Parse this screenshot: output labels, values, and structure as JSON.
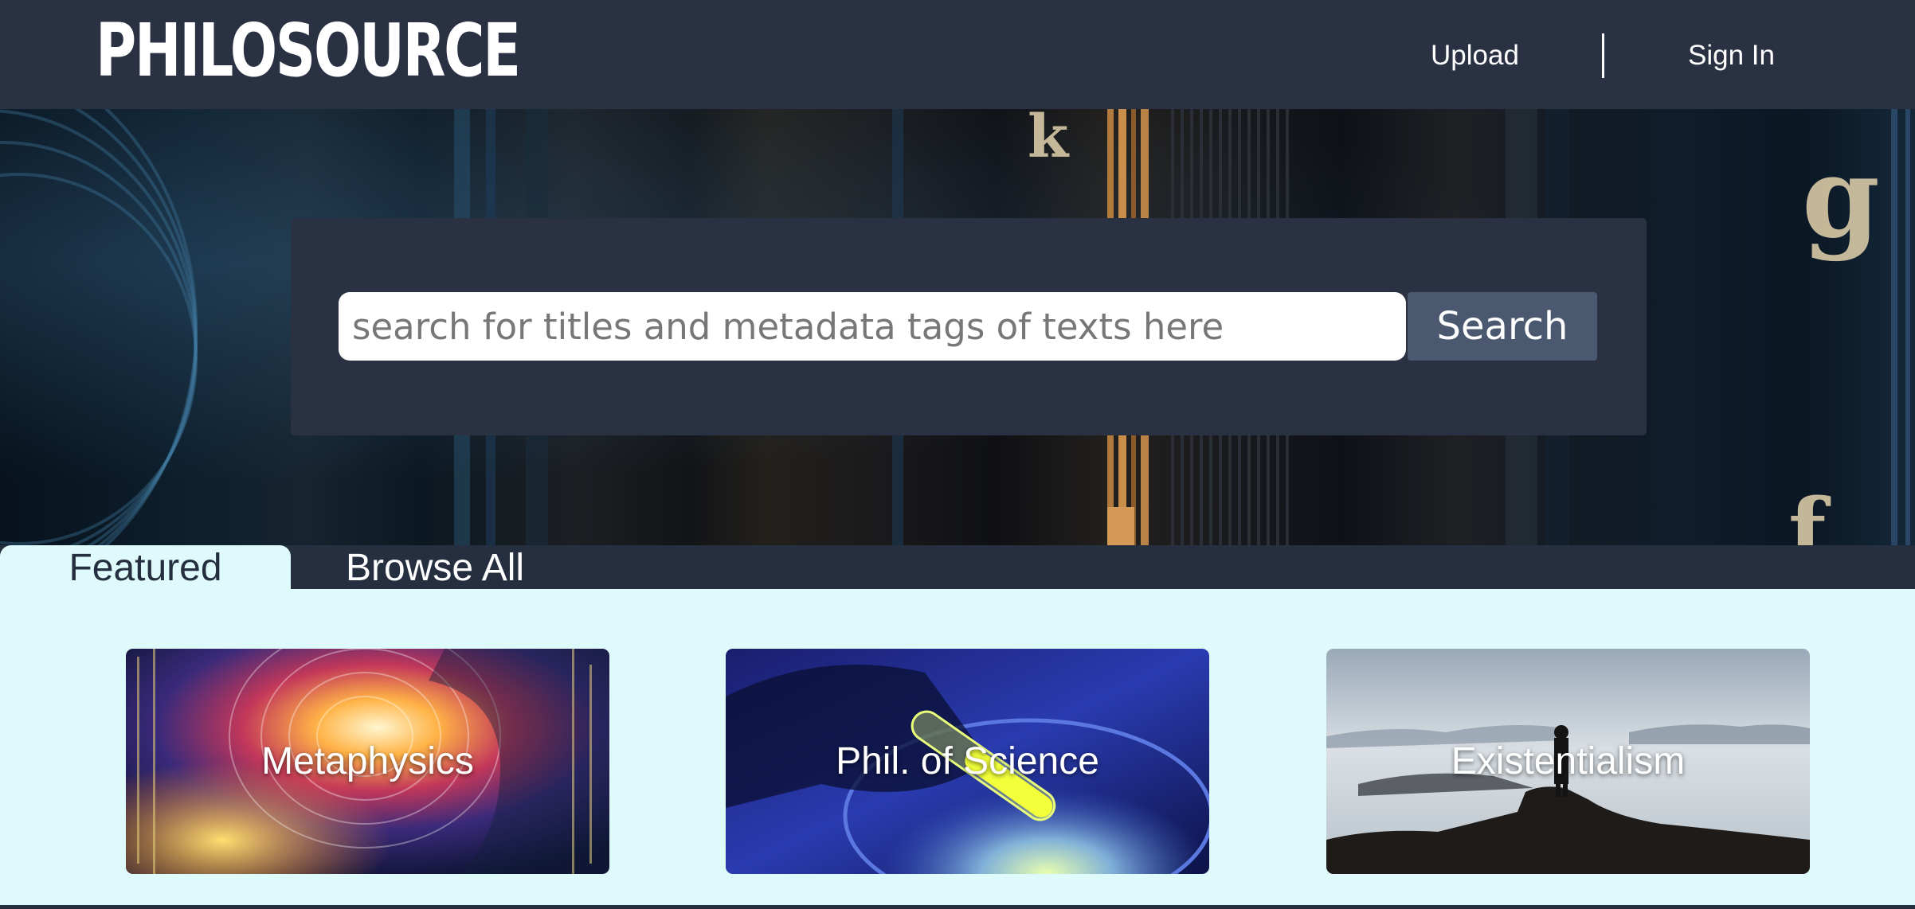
{
  "header": {
    "logo": "PHILOSOURCE",
    "nav": {
      "upload": "Upload",
      "sign_in": "Sign In"
    }
  },
  "hero": {
    "search": {
      "placeholder": "search for titles and metadata tags of texts here",
      "button_label": "Search"
    }
  },
  "tabs": [
    {
      "label": "Featured",
      "active": true
    },
    {
      "label": "Browse All",
      "active": false
    }
  ],
  "featured": [
    {
      "label": "Metaphysics",
      "image": "abstract-cosmic-mind-head"
    },
    {
      "label": "Phil. of Science",
      "image": "glowing-test-tube-petri-dish"
    },
    {
      "label": "Existentialism",
      "image": "wanderer-above-sea-of-fog"
    }
  ],
  "colors": {
    "header_bg": "#293142",
    "panel_bg": "#293142",
    "search_button_bg": "#4a5870",
    "content_bg": "#defafa",
    "text_light": "#ffffff"
  }
}
